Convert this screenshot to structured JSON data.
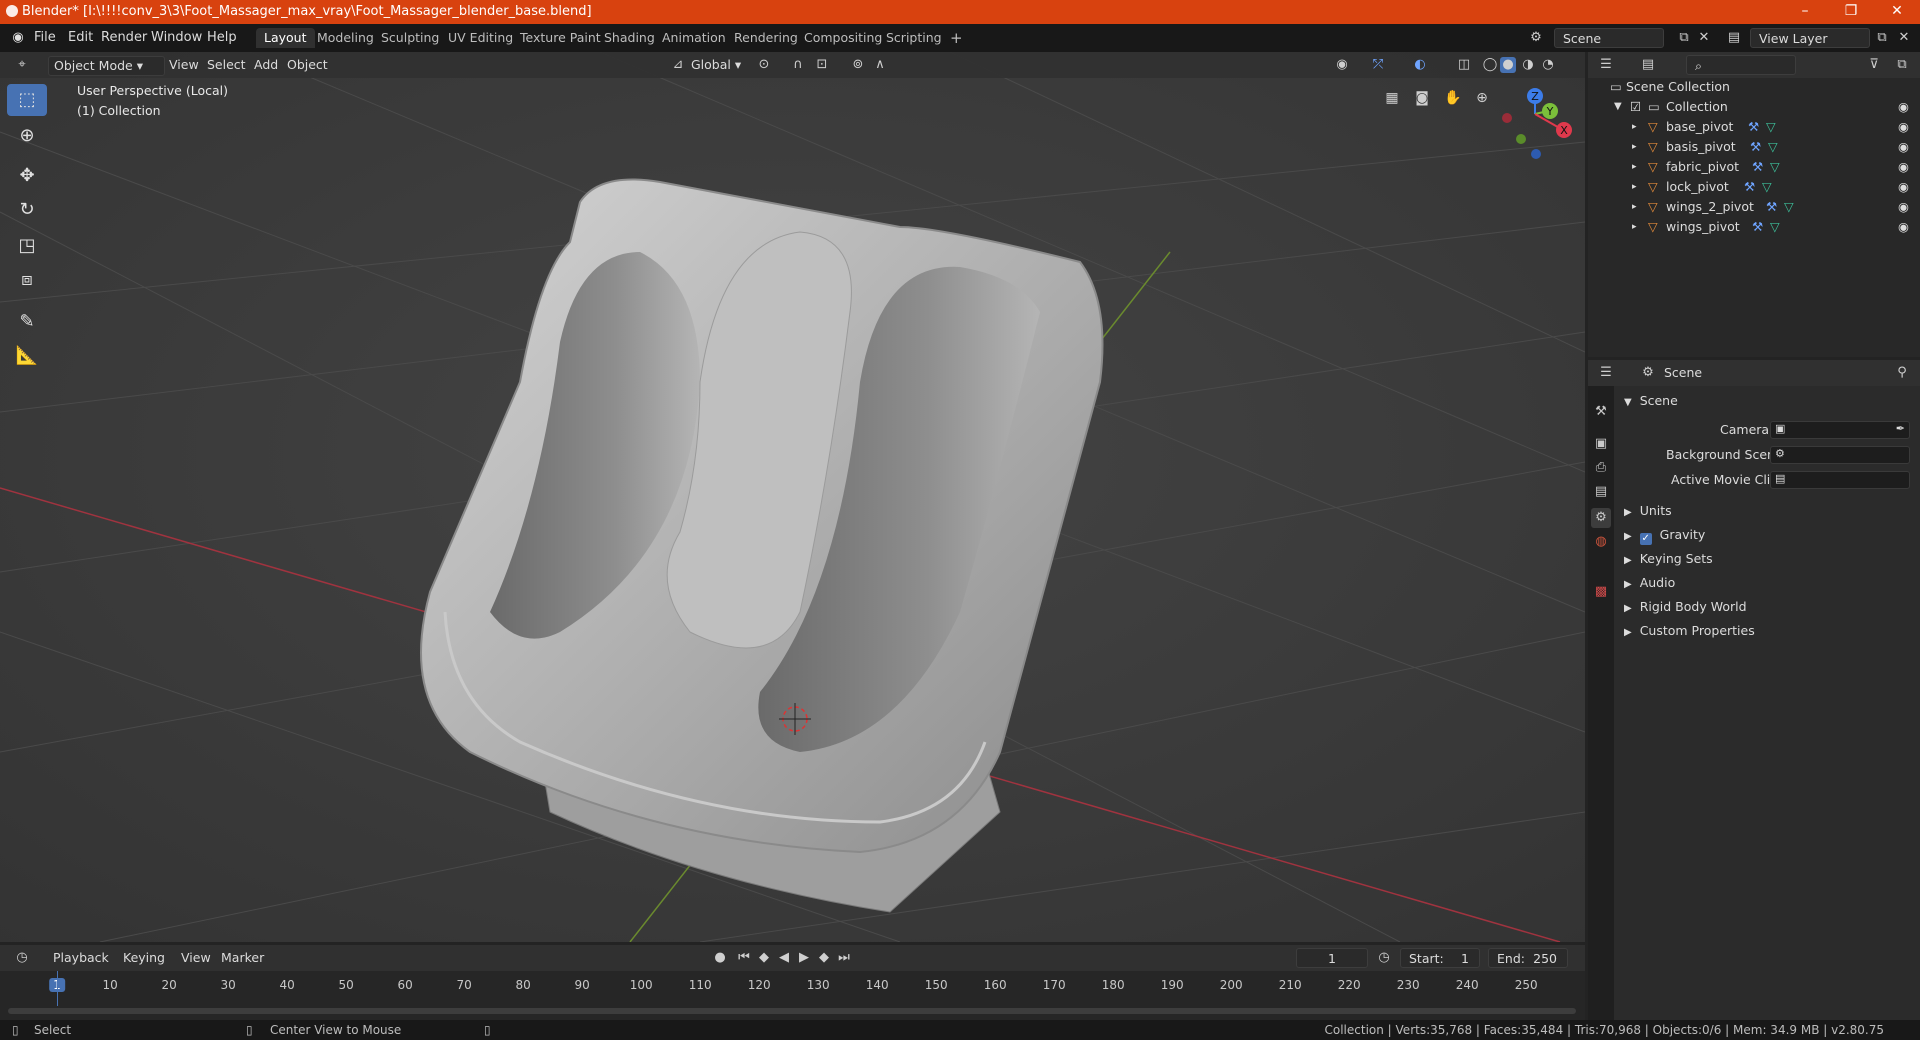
{
  "window": {
    "title": "Blender* [I:\\!!!!conv_3\\3\\Foot_Massager_max_vray\\Foot_Massager_blender_base.blend]",
    "minimize": "–",
    "maximize": "❐",
    "close": "✕"
  },
  "menu": [
    "File",
    "Edit",
    "Render",
    "Window",
    "Help"
  ],
  "workspaces": [
    "Layout",
    "Modeling",
    "Sculpting",
    "UV Editing",
    "Texture Paint",
    "Shading",
    "Animation",
    "Rendering",
    "Compositing",
    "Scripting"
  ],
  "add_workspace": "+",
  "scene_name": "Scene",
  "view_layer": "View Layer",
  "viewport": {
    "mode": "Object Mode",
    "menus": [
      "View",
      "Select",
      "Add",
      "Object"
    ],
    "transform_orientation": "Global",
    "perspective_label": "User Perspective (Local)",
    "collection_label": "(1) Collection",
    "gizmo": {
      "x": "X",
      "y": "Y",
      "z": "Z"
    }
  },
  "outliner": {
    "root": "Scene Collection",
    "collection": "Collection",
    "objects": [
      "base_pivot",
      "basis_pivot",
      "fabric_pivot",
      "lock_pivot",
      "wings_2_pivot",
      "wings_pivot"
    ]
  },
  "properties": {
    "context": "Scene",
    "panel_title": "Scene",
    "camera_label": "Camera",
    "background_scene_label": "Background Scene",
    "active_movie_clip_label": "Active Movie Clip",
    "panels": [
      "Units",
      "Gravity",
      "Keying Sets",
      "Audio",
      "Rigid Body World",
      "Custom Properties"
    ],
    "gravity_checked": true
  },
  "timeline": {
    "menus": [
      "Playback",
      "Keying",
      "View",
      "Marker"
    ],
    "current_frame": "1",
    "start_label": "Start:",
    "start": "1",
    "end_label": "End:",
    "end": "250",
    "ticks": [
      "1",
      "10",
      "20",
      "30",
      "40",
      "50",
      "60",
      "70",
      "80",
      "90",
      "100",
      "110",
      "120",
      "130",
      "140",
      "150",
      "160",
      "170",
      "180",
      "190",
      "200",
      "210",
      "220",
      "230",
      "240",
      "250"
    ]
  },
  "status": {
    "select": "Select",
    "center_view": "Center View to Mouse",
    "stats": "Collection | Verts:35,768 | Faces:35,484 | Tris:70,968 | Objects:0/6 | Mem: 34.9 MB | v2.80.75"
  },
  "colors": {
    "titlebar": "#d8420f",
    "active_tool": "#4772b3",
    "object_icon": "#e08a3a",
    "x_axis": "#e0394c",
    "y_axis": "#7bbf3a",
    "z_axis": "#3c7ce8"
  }
}
